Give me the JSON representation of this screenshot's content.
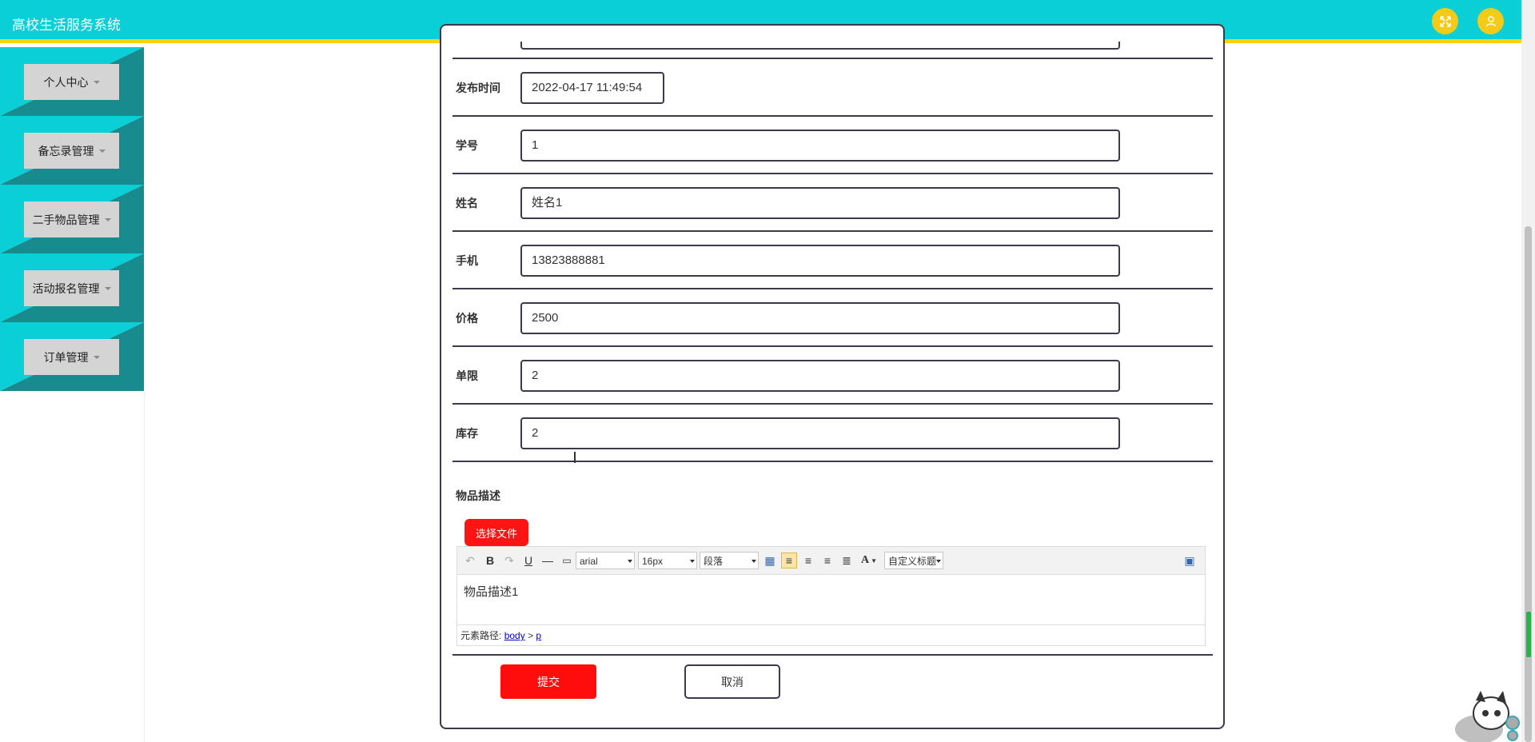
{
  "header": {
    "app_title": "高校生活服务系统",
    "fullscreen_icon": "expand-icon",
    "user_icon": "user-icon",
    "accent": "#0bcfd6",
    "underline": "#f6d40e"
  },
  "sidebar": {
    "items": [
      {
        "label": "个人中心"
      },
      {
        "label": "备忘录管理"
      },
      {
        "label": "二手物品管理"
      },
      {
        "label": "活动报名管理"
      },
      {
        "label": "订单管理"
      }
    ]
  },
  "form": {
    "fields": [
      {
        "label": "发布时间",
        "value": "2022-04-17 11:49:54"
      },
      {
        "label": "学号",
        "value": "1"
      },
      {
        "label": "姓名",
        "value": "姓名1"
      },
      {
        "label": "手机",
        "value": "13823888881"
      },
      {
        "label": "价格",
        "value": "2500"
      },
      {
        "label": "单限",
        "value": "2"
      },
      {
        "label": "库存",
        "value": "2"
      }
    ],
    "description": {
      "label": "物品描述",
      "choose_file": "选择文件",
      "toolbar": {
        "font_family": "arial",
        "font_size": "16px",
        "paragraph": "段落",
        "custom_title": "自定义标题",
        "bold": "B",
        "underline": "U",
        "font_color": "A"
      },
      "content": "物品描述1",
      "path_label": "元素路径:",
      "path_body": "body",
      "path_sep": ">",
      "path_p": "p"
    },
    "submit": "提交",
    "cancel": "取消"
  }
}
